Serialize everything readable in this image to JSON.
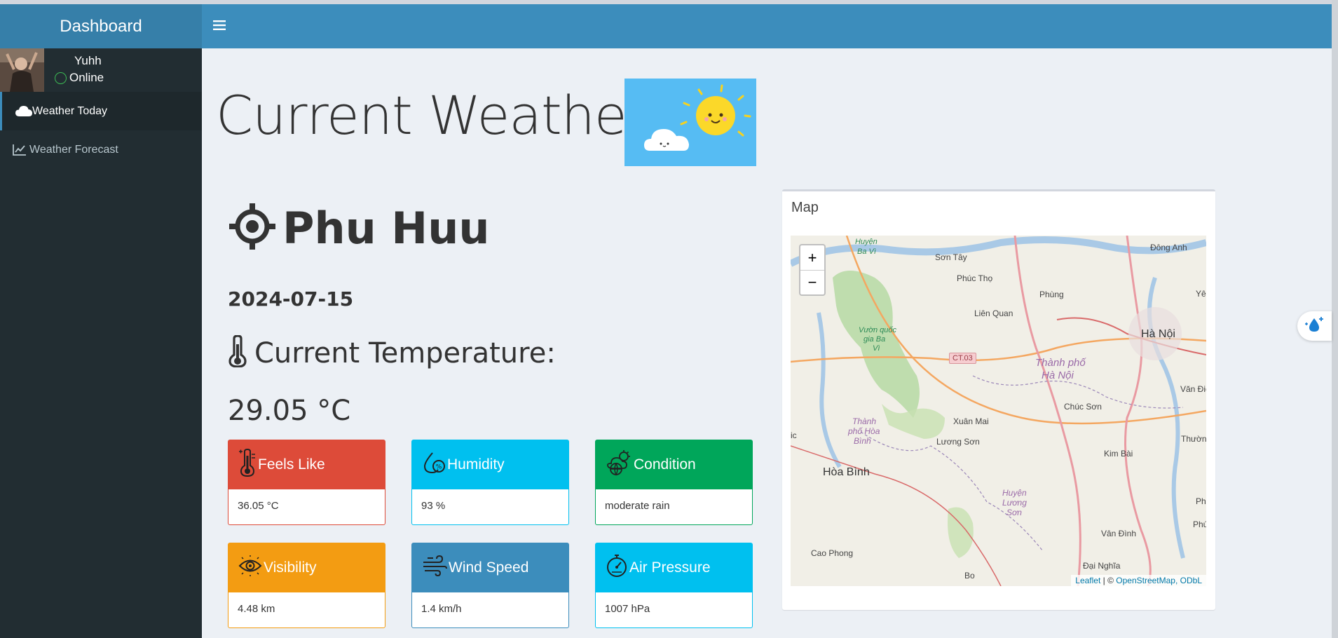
{
  "header": {
    "brand": "Dashboard",
    "toggle_icon": "hamburger-icon"
  },
  "user": {
    "name": "Yuhh",
    "status": "Online"
  },
  "sidebar": {
    "items": [
      {
        "label": "Weather Today",
        "icon": "cloud-icon",
        "active": true
      },
      {
        "label": "Weather Forecast",
        "icon": "line-chart-icon",
        "active": false
      }
    ]
  },
  "main": {
    "title": "Current Weather",
    "location": "Phu Huu",
    "date": "2024-07-15",
    "temperature_label": "Current Temperature:",
    "temperature_value": "29.05 °C"
  },
  "stats": [
    {
      "label": "Feels Like",
      "value": "36.05 °C",
      "icon": "thermometer-icon",
      "color": "#dd4b39"
    },
    {
      "label": "Humidity",
      "value": "93 %",
      "icon": "humidity-drop-icon",
      "color": "#00c0ef"
    },
    {
      "label": "Condition",
      "value": "moderate rain",
      "icon": "cloud-sun-globe-icon",
      "color": "#00a65a"
    },
    {
      "label": "Visibility",
      "value": "4.48 km",
      "icon": "eye-icon",
      "color": "#f39c12"
    },
    {
      "label": "Wind Speed",
      "value": "1.4 km/h",
      "icon": "wind-icon",
      "color": "#3c8dbc"
    },
    {
      "label": "Air Pressure",
      "value": "1007 hPa",
      "icon": "pressure-gauge-icon",
      "color": "#00c0ef"
    }
  ],
  "map": {
    "title": "Map",
    "zoom_in": "+",
    "zoom_out": "−",
    "attribution": {
      "leaflet": "Leaflet",
      "sep": " | © ",
      "osm": "OpenStreetMap, ODbL"
    },
    "labels": {
      "son_tay": "Sơn Tây",
      "phuc_tho": "Phúc Thọ",
      "phung": "Phùng",
      "dong_anh": "Đông Anh",
      "lien_quan": "Liên Quan",
      "ha_noi": "Hà Nội",
      "ct03": "CT.03",
      "thanh_pho_ha_noi_1": "Thành phố",
      "thanh_pho_ha_noi_2": "Hà Nội",
      "chuc_son": "Chúc Sơn",
      "van_dien": "Văn Điển",
      "xuan_mai": "Xuân Mai",
      "luong_son": "Lương Sơn",
      "hoa_binh": "Hòa Bình",
      "kim_bai": "Kim Bài",
      "thuong_tin": "Thường Tín",
      "van_dinh": "Vân Đình",
      "cao_phong": "Cao Phong",
      "dai_nghia": "Đại Nghĩa",
      "bo": "Bo",
      "vuon_quoc_gia_1": "Vườn quốc",
      "vuon_quoc_gia_2": "gia Ba",
      "vuon_quoc_gia_3": "Vì",
      "huyen_ba_vi_1": "Huyện",
      "huyen_ba_vi_2": "Ba Vì",
      "tp_hoa_binh_1": "Thành",
      "tp_hoa_binh_2": "phố Hòa",
      "tp_hoa_binh_3": "Bình",
      "huyen_luong_son_1": "Huyện",
      "huyen_luong_son_2": "Lương",
      "huyen_luong_son_3": "Sơn",
      "ye": "Yê",
      "ph": "Ph",
      "phu": "Phú",
      "ic": "ic"
    }
  },
  "floating_button_icon": "water-sparkle-icon"
}
